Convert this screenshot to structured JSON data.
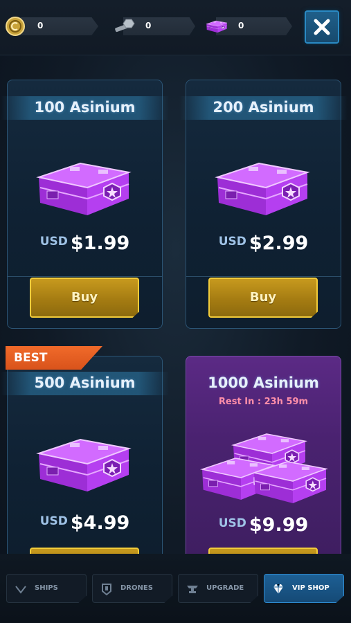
{
  "currencies": {
    "coins": {
      "icon": "coin-icon",
      "value": "0"
    },
    "bolts": {
      "icon": "bolt-icon",
      "value": "0"
    },
    "crates": {
      "icon": "crate-icon",
      "value": "0"
    }
  },
  "close": {
    "icon": "close-icon"
  },
  "offers": [
    {
      "title": "100 Asinium",
      "currency": "USD",
      "price": "$1.99",
      "buy_label": "Buy"
    },
    {
      "title": "200 Asinium",
      "currency": "USD",
      "price": "$2.99",
      "buy_label": "Buy"
    },
    {
      "title": "500 Asinium",
      "currency": "USD",
      "price": "$4.99",
      "badge": "BEST"
    },
    {
      "title": "1000 Asinium",
      "subtitle": "Rest In : 23h 59m",
      "currency": "USD",
      "price": "$9.99"
    }
  ],
  "nav": {
    "tabs": [
      {
        "label": "SHIPS",
        "icon": "ship-icon",
        "active": false
      },
      {
        "label": "DRONES",
        "icon": "drone-icon",
        "active": false
      },
      {
        "label": "UPGRADE",
        "icon": "anvil-icon",
        "active": false
      },
      {
        "label": "VIP SHOP",
        "icon": "diamond-icon",
        "active": true
      }
    ]
  },
  "colors": {
    "accent_blue": "#2a8ac4",
    "buy_gold": "#c79a1e",
    "best_orange": "#f06a2a",
    "vip_purple": "#5b2a85"
  }
}
